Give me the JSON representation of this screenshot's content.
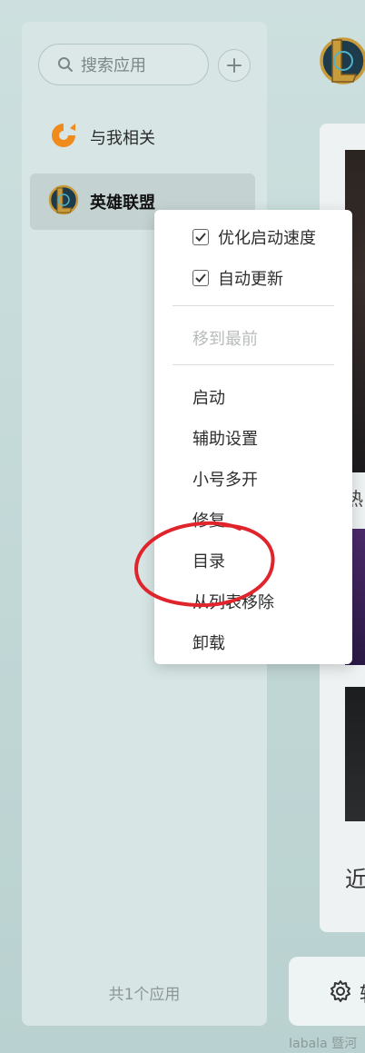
{
  "sidebar": {
    "search_placeholder": "搜索应用",
    "items": [
      {
        "label": "与我相关"
      },
      {
        "label": "英雄联盟"
      }
    ],
    "footer": "共1个应用"
  },
  "content": {
    "hot_label": "热",
    "recent_label": "近",
    "settings_label": "辅"
  },
  "context_menu": {
    "checkbox_items": [
      {
        "label": "优化启动速度",
        "checked": true
      },
      {
        "label": "自动更新",
        "checked": true
      }
    ],
    "disabled_item": "移到最前",
    "items": [
      "启动",
      "辅助设置",
      "小号多开",
      "修复",
      "目录",
      "从列表移除",
      "卸载"
    ]
  },
  "annotation": {
    "color": "#e0242b",
    "circled_item": "目录"
  },
  "colors": {
    "accent_orange": "#f08a1c",
    "sidebar_bg": "#d7e6e5",
    "page_bg": "#c7dcdb"
  },
  "watermark": "Iabala 暨河"
}
